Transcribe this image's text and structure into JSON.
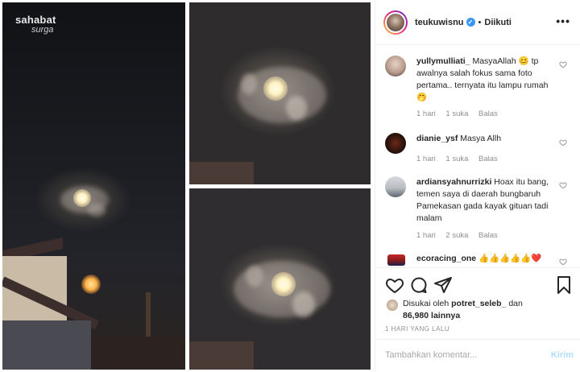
{
  "watermark": {
    "line1": "sahabat",
    "line2": "surga"
  },
  "post": {
    "username": "teukuwisnu",
    "follow_status": "Diikuti",
    "more_label": "•••"
  },
  "comments": [
    {
      "username": "yullymulliati_",
      "text": "MasyaAllah 😊 tp awalnya salah fokus sama foto pertama.. ternyata itu lampu rumah 🤭",
      "time": "1 hari",
      "likes": "1 suka",
      "reply": "Balas"
    },
    {
      "username": "dianie_ysf",
      "text": "Masya Allh",
      "time": "1 hari",
      "likes": "1 suka",
      "reply": "Balas"
    },
    {
      "username": "ardiansyahnurrizki",
      "text": "Hoax itu bang, temen saya di daerah bungbaruh Pamekasan gada kayak gituan tadi malam",
      "time": "1 hari",
      "likes": "2 suka",
      "reply": "Balas"
    },
    {
      "username": "ecoracing_one",
      "text": "👍👍👍👍👍❤️",
      "time": "",
      "likes": "",
      "reply": ""
    }
  ],
  "likes": {
    "prefix": "Disukai oleh",
    "user": "potret_seleb_",
    "joiner": "dan",
    "count": "86,980 lainnya"
  },
  "timestamp": "1 HARI YANG LALU",
  "add_comment": {
    "placeholder": "Tambahkan komentar...",
    "post_label": "Kirim"
  },
  "colors": {
    "verified": "#3897f0",
    "post_button_disabled": "#b2dffc",
    "meta_text": "#8e8e8e"
  }
}
